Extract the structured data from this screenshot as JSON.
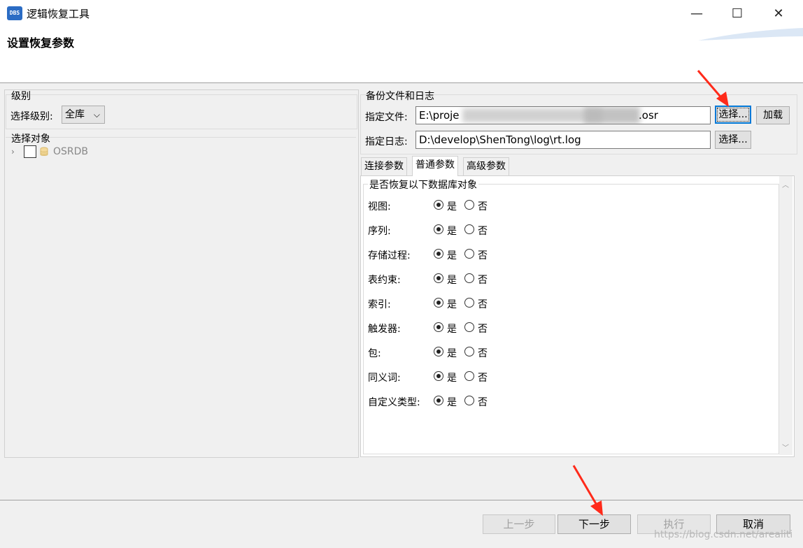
{
  "window": {
    "title": "逻辑恢复工具",
    "icon_text": "DBS",
    "minimize": "—",
    "maximize": "☐",
    "close": "✕"
  },
  "page_title": "设置恢复参数",
  "left": {
    "level_group_title": "级别",
    "level_label": "选择级别:",
    "level_value": "全库",
    "object_group_title": "选择对象",
    "tree_root_label": "OSRDB"
  },
  "backup": {
    "group_title": "备份文件和日志",
    "file_label": "指定文件:",
    "file_value_start": "E:\\proje",
    "file_value_end": ".osr",
    "file_choose": "选择...",
    "load": "加载",
    "log_label": "指定日志:",
    "log_value": "D:\\develop\\ShenTong\\log\\rt.log",
    "log_choose": "选择..."
  },
  "tabs": [
    "连接参数",
    "普通参数",
    "高级参数"
  ],
  "options": {
    "group_title": "是否恢复以下数据库对象",
    "yes": "是",
    "no": "否",
    "rows": [
      {
        "label": "视图:",
        "value": "是"
      },
      {
        "label": "序列:",
        "value": "是"
      },
      {
        "label": "存储过程:",
        "value": "是"
      },
      {
        "label": "表约束:",
        "value": "是"
      },
      {
        "label": "索引:",
        "value": "是"
      },
      {
        "label": "触发器:",
        "value": "是"
      },
      {
        "label": "包:",
        "value": "是"
      },
      {
        "label": "同义词:",
        "value": "是"
      },
      {
        "label": "自定义类型:",
        "value": "是"
      }
    ]
  },
  "footer": {
    "prev": "上一步",
    "next": "下一步",
    "execute": "执行",
    "cancel": "取消"
  },
  "watermark": "https://blog.csdn.net/arealiti",
  "colors": {
    "accent": "#0078d7",
    "annotation_arrow": "#ff2a1a",
    "icon_bg": "#2b6cc4"
  }
}
